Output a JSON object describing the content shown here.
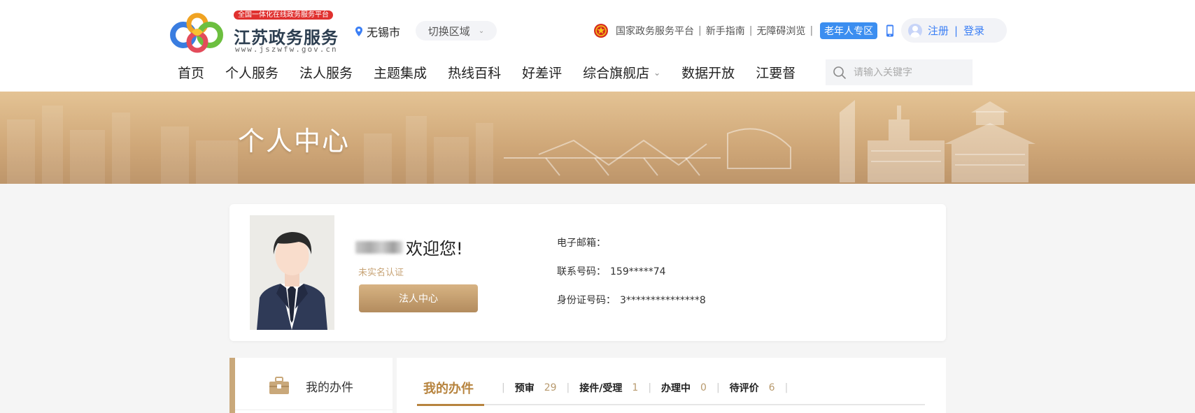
{
  "header": {
    "logo_tag": "全国一体化在线政务服务平台",
    "logo_name": "江苏政务服务",
    "logo_url": "www.jszwfw.gov.cn",
    "city": "无锡市",
    "switch_region": "切换区域",
    "national_platform": "国家政务服务平台",
    "newbie_guide": "新手指南",
    "accessible": "无障碍浏览",
    "elder_zone": "老年人专区",
    "register": "注册",
    "login": "登录",
    "separator": "|"
  },
  "nav": {
    "items": [
      "首页",
      "个人服务",
      "法人服务",
      "主题集成",
      "热线百科",
      "好差评",
      "综合旗舰店",
      "数据开放",
      "江要督"
    ],
    "search_placeholder": "请输入关键字"
  },
  "banner": {
    "title": "个人中心"
  },
  "profile": {
    "welcome": "欢迎您!",
    "realname_status": "未实名认证",
    "legal_center_button": "法人中心",
    "email_label": "电子邮箱：",
    "email_value": "",
    "phone_label": "联系号码：",
    "phone_value": "159*****74",
    "id_label": "身份证号码：",
    "id_value": "3***************8"
  },
  "sidebar": {
    "my_items": "我的办件"
  },
  "tabs": {
    "title": "我的办件",
    "items": [
      {
        "name": "预审",
        "count": "29"
      },
      {
        "name": "接件/受理",
        "count": "1"
      },
      {
        "name": "办理中",
        "count": "0"
      },
      {
        "name": "待评价",
        "count": "6"
      }
    ]
  },
  "colors": {
    "accent_gold": "#b7843f",
    "banner": "#cfa778",
    "link_blue": "#3b7ff5",
    "elder_badge": "#3b8ef0",
    "logo_tag_red": "#e0312f"
  },
  "icons": [
    "location-pin-icon",
    "chevron-down-icon",
    "national-emblem-icon",
    "mobile-phone-icon",
    "user-avatar-icon",
    "search-icon",
    "briefcase-icon"
  ]
}
